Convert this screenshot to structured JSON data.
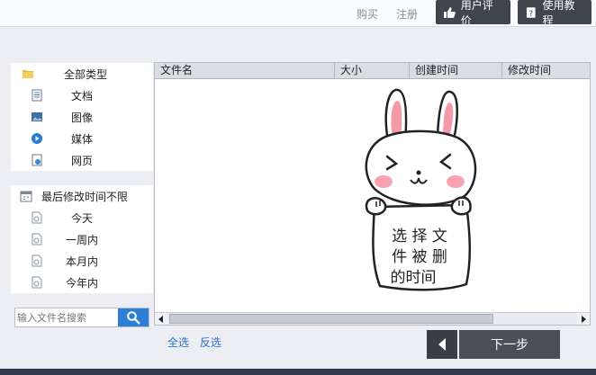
{
  "top": {
    "buy": "购买",
    "register": "注册",
    "review_btn": "用户评价",
    "tutorial_btn": "使用教程"
  },
  "filters": {
    "types_header": "全部类型",
    "types": [
      "文档",
      "图像",
      "媒体",
      "网页"
    ],
    "time_header": "最后修改时间不限",
    "times": [
      "今天",
      "一周内",
      "本月内",
      "今年内"
    ]
  },
  "search": {
    "placeholder": "输入文件名搜索"
  },
  "table": {
    "columns": [
      "文件名",
      "大小",
      "创建时间",
      "修改时间"
    ]
  },
  "illustration": {
    "caption_line1": "选 择 文",
    "caption_line2": "件 被 删",
    "caption_line3": "的时间"
  },
  "actions": {
    "select_all": "全选",
    "invert": "反选",
    "next": "下一步"
  },
  "colors": {
    "accent": "#2d7fd6",
    "dark_button": "#3f454d"
  }
}
